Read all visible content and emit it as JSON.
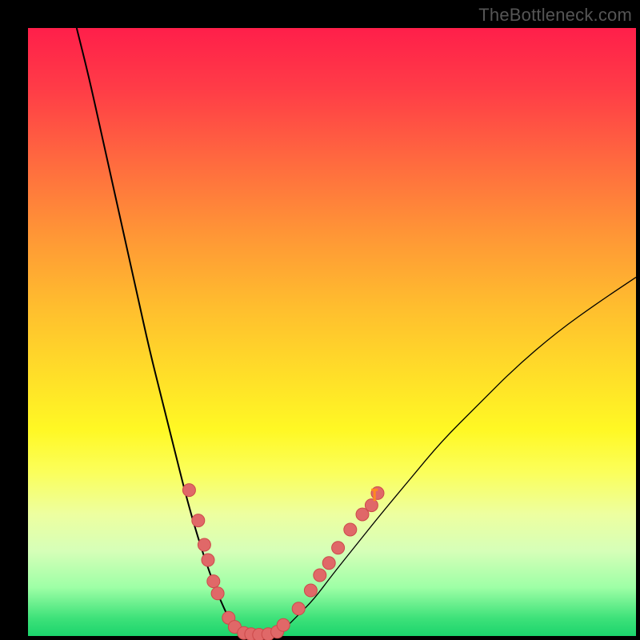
{
  "watermark": "TheBottleneck.com",
  "colors": {
    "background": "#000000",
    "dot_fill": "#e06868",
    "dot_stroke": "#cc4a4a",
    "curve": "#000000"
  },
  "chart_data": {
    "type": "line",
    "title": "",
    "xlabel": "",
    "ylabel": "",
    "xlim": [
      0,
      100
    ],
    "ylim": [
      0,
      100
    ],
    "series": [
      {
        "name": "bottleneck-curve-left",
        "x": [
          8,
          10,
          12,
          14,
          16,
          18,
          20,
          22,
          24,
          26,
          28,
          30,
          32,
          34,
          35
        ],
        "y": [
          100,
          92,
          83,
          74,
          65,
          56,
          47,
          39,
          31,
          23,
          16,
          10,
          5,
          1,
          0
        ]
      },
      {
        "name": "bottleneck-curve-right",
        "x": [
          40,
          42,
          44,
          47,
          50,
          54,
          58,
          63,
          68,
          74,
          80,
          87,
          94,
          100
        ],
        "y": [
          0,
          1,
          3,
          6,
          10,
          15,
          20,
          26,
          32,
          38,
          44,
          50,
          55,
          59
        ]
      }
    ],
    "markers": [
      {
        "x": 26.5,
        "y": 24
      },
      {
        "x": 28.0,
        "y": 19
      },
      {
        "x": 29.0,
        "y": 15
      },
      {
        "x": 29.6,
        "y": 12.5
      },
      {
        "x": 30.5,
        "y": 9
      },
      {
        "x": 31.2,
        "y": 7
      },
      {
        "x": 33.0,
        "y": 3
      },
      {
        "x": 34.0,
        "y": 1.5
      },
      {
        "x": 35.5,
        "y": 0.5
      },
      {
        "x": 36.7,
        "y": 0.3
      },
      {
        "x": 38.0,
        "y": 0.2
      },
      {
        "x": 39.5,
        "y": 0.3
      },
      {
        "x": 41.0,
        "y": 0.7
      },
      {
        "x": 42.0,
        "y": 1.8
      },
      {
        "x": 44.5,
        "y": 4.5
      },
      {
        "x": 46.5,
        "y": 7.5
      },
      {
        "x": 48.0,
        "y": 10
      },
      {
        "x": 49.5,
        "y": 12
      },
      {
        "x": 51.0,
        "y": 14.5
      },
      {
        "x": 53.0,
        "y": 17.5
      },
      {
        "x": 55.0,
        "y": 20
      },
      {
        "x": 57.5,
        "y": 23.5
      }
    ],
    "extra_markers": [
      {
        "x": 56.5,
        "y": 21.5
      }
    ]
  }
}
